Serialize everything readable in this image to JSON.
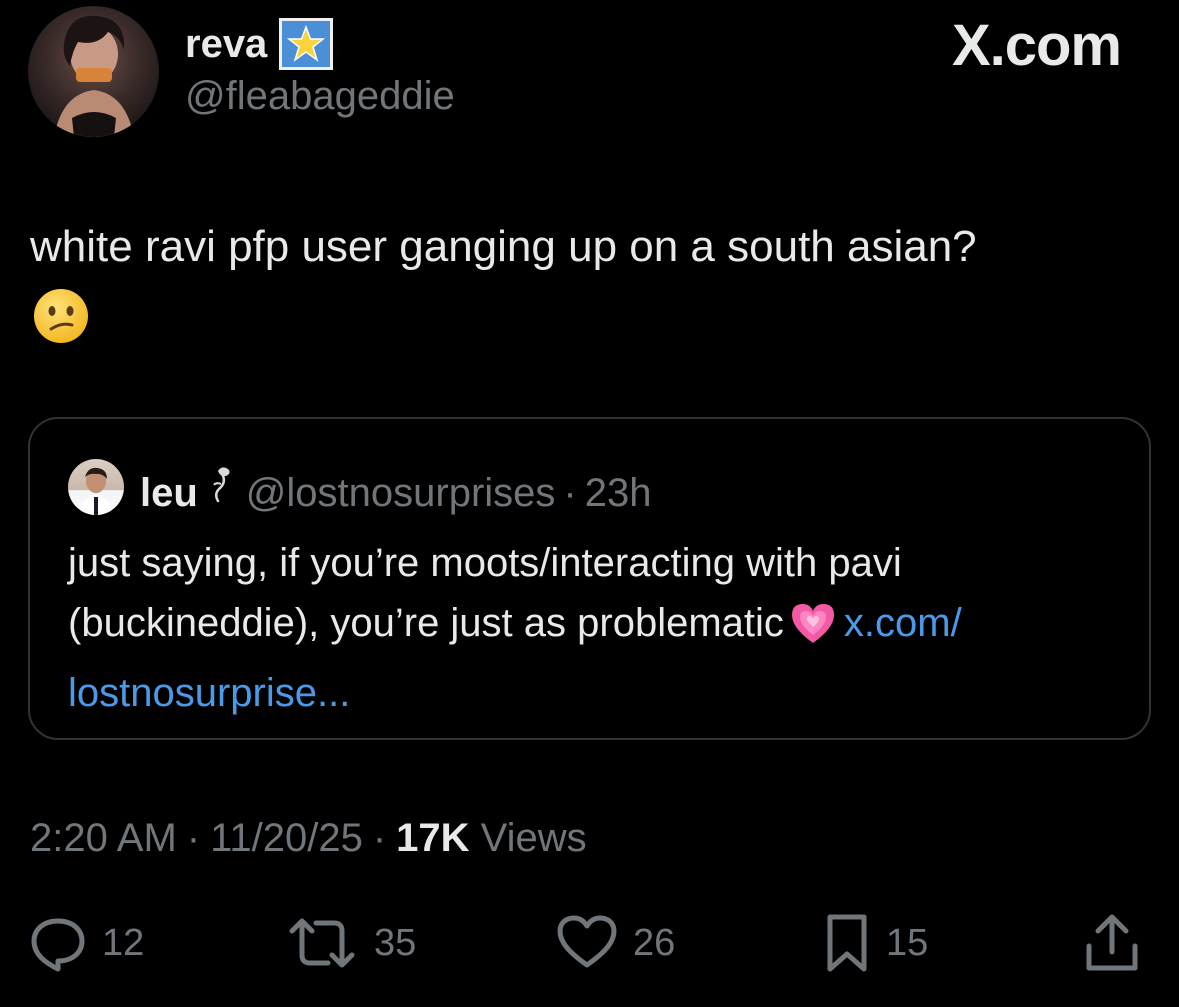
{
  "header": {
    "display_name": "reva",
    "handle": "@fleabageddie",
    "brand": "X.com"
  },
  "tweet": {
    "text": "white ravi pfp user ganging up on a south asian?",
    "emoji": "confused-face-emoji"
  },
  "quote": {
    "name": "leu",
    "handle": "@lostnosurprises",
    "separator": "·",
    "time": "23h",
    "text_part1": "just saying, if you’re moots/interacting with pavi (buckineddie), you’re just as problematic",
    "emoji": "growing-heart-emoji",
    "link_text": "x.com/ lostnosurprise..."
  },
  "meta": {
    "time": "2:20 AM",
    "sep1": "·",
    "date": "11/20/25",
    "sep2": "·",
    "views_count": "17K",
    "views_label": "Views"
  },
  "actions": {
    "replies": "12",
    "reposts": "35",
    "likes": "26",
    "bookmarks": "15"
  },
  "colors": {
    "background": "#000000",
    "text": "#e7e9ea",
    "muted": "#71767b",
    "link": "#4a9ae9",
    "border": "#2f3336"
  }
}
